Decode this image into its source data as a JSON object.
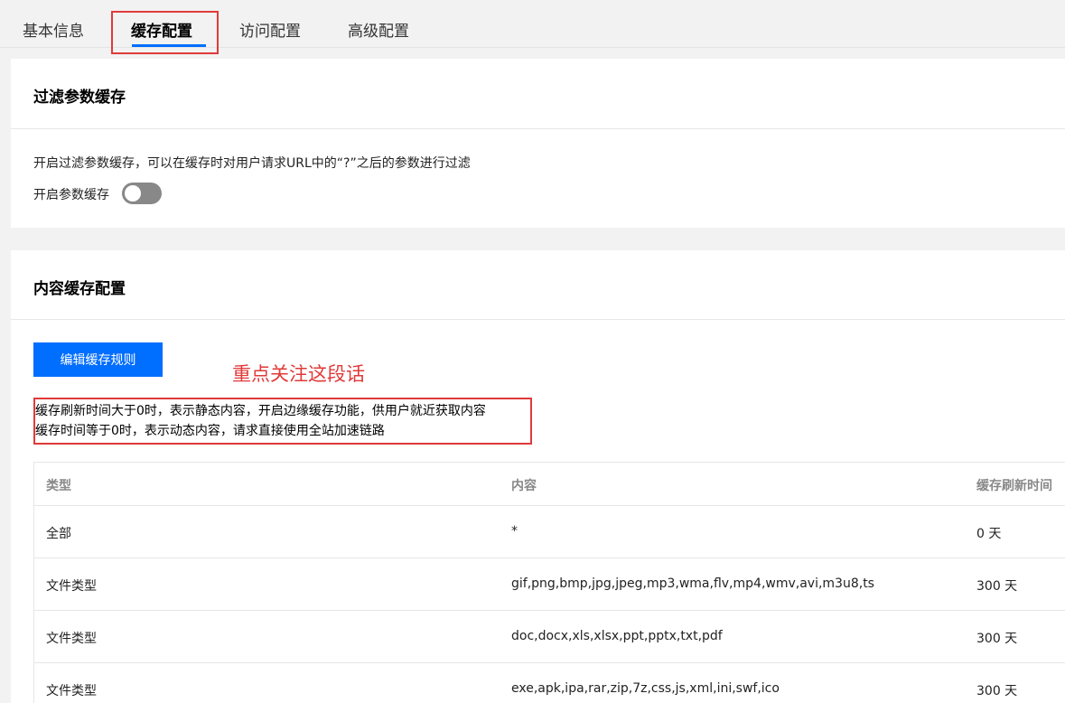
{
  "tabs": [
    {
      "label": "基本信息"
    },
    {
      "label": "缓存配置"
    },
    {
      "label": "访问配置"
    },
    {
      "label": "高级配置"
    }
  ],
  "filter_cache": {
    "title": "过滤参数缓存",
    "description": "开启过滤参数缓存，可以在缓存时对用户请求URL中的“?”之后的参数进行过滤",
    "switch_label": "开启参数缓存",
    "switch_on": false
  },
  "content_cache": {
    "title": "内容缓存配置",
    "edit_button": "编辑缓存规则",
    "annotation": "重点关注这段话",
    "notes": [
      "缓存刷新时间大于0时，表示静态内容，开启边缘缓存功能，供用户就近获取内容",
      "缓存时间等于0时，表示动态内容，请求直接使用全站加速链路"
    ],
    "table": {
      "headers": [
        "类型",
        "内容",
        "缓存刷新时间"
      ],
      "rows": [
        {
          "type": "全部",
          "content": "*",
          "time": "0 天"
        },
        {
          "type": "文件类型",
          "content": "gif,png,bmp,jpg,jpeg,mp3,wma,flv,mp4,wmv,avi,m3u8,ts",
          "time": "300 天"
        },
        {
          "type": "文件类型",
          "content": "doc,docx,xls,xlsx,ppt,pptx,txt,pdf",
          "time": "300 天"
        },
        {
          "type": "文件类型",
          "content": "exe,apk,ipa,rar,zip,7z,css,js,xml,ini,swf,ico",
          "time": "300 天"
        }
      ]
    }
  },
  "colors": {
    "accent": "#006eff",
    "annotation": "#e03a3a"
  }
}
